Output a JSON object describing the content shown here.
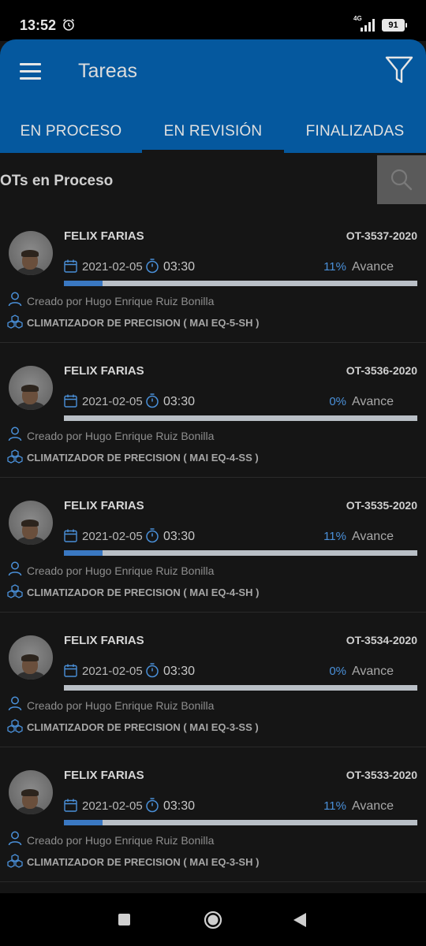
{
  "status_bar": {
    "time": "13:52",
    "network": "4G",
    "battery": "91"
  },
  "app_bar": {
    "title": "Tareas",
    "tabs": [
      {
        "label": "EN PROCESO"
      },
      {
        "label": "EN REVISIÓN"
      },
      {
        "label": "FINALIZADAS"
      }
    ]
  },
  "section": {
    "title": "OTs en Proceso"
  },
  "labels": {
    "avance": "Avance"
  },
  "colors": {
    "accent": "#05589e",
    "progress": "#3a78c2",
    "percent_text": "#4a90d9"
  },
  "items": [
    {
      "name": "FELIX FARIAS",
      "ot": "OT-3537-2020",
      "date": "2021-02-05",
      "duration": "03:30",
      "percent": "11%",
      "progress": 0.11,
      "creator": "Creado por Hugo Enrique  Ruiz Bonilla",
      "equipment": "CLIMATIZADOR DE PRECISION ( MAI EQ-5-SH )"
    },
    {
      "name": "FELIX FARIAS",
      "ot": "OT-3536-2020",
      "date": "2021-02-05",
      "duration": "03:30",
      "percent": "0%",
      "progress": 0,
      "creator": "Creado por Hugo Enrique  Ruiz Bonilla",
      "equipment": "CLIMATIZADOR DE PRECISION ( MAI EQ-4-SS )"
    },
    {
      "name": "FELIX FARIAS",
      "ot": "OT-3535-2020",
      "date": "2021-02-05",
      "duration": "03:30",
      "percent": "11%",
      "progress": 0.11,
      "creator": "Creado por Hugo Enrique  Ruiz Bonilla",
      "equipment": "CLIMATIZADOR DE PRECISION ( MAI EQ-4-SH )"
    },
    {
      "name": "FELIX FARIAS",
      "ot": "OT-3534-2020",
      "date": "2021-02-05",
      "duration": "03:30",
      "percent": "0%",
      "progress": 0,
      "creator": "Creado por Hugo Enrique  Ruiz Bonilla",
      "equipment": "CLIMATIZADOR DE PRECISION ( MAI EQ-3-SS )"
    },
    {
      "name": "FELIX FARIAS",
      "ot": "OT-3533-2020",
      "date": "2021-02-05",
      "duration": "03:30",
      "percent": "11%",
      "progress": 0.11,
      "creator": "Creado por Hugo Enrique  Ruiz Bonilla",
      "equipment": "CLIMATIZADOR DE PRECISION ( MAI EQ-3-SH )"
    }
  ]
}
